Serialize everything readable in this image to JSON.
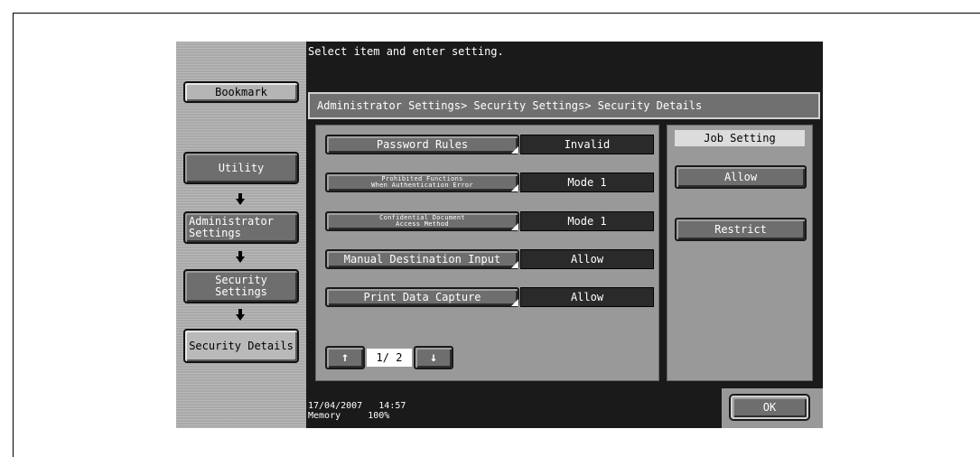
{
  "message": "Select item and enter setting.",
  "breadcrumb": "Administrator Settings> Security Settings> Security Details",
  "sidebar": {
    "bookmark_label": "Bookmark",
    "items": [
      {
        "label": "Utility"
      },
      {
        "label": "Administrator\nSettings"
      },
      {
        "label": "Security\nSettings"
      },
      {
        "label": "Security Details"
      }
    ]
  },
  "settings": [
    {
      "label": "Password Rules",
      "value": "Invalid"
    },
    {
      "label": "Prohibited Functions\nWhen Authentication Error",
      "value": "Mode 1"
    },
    {
      "label": "Confidential Document\nAccess Method",
      "value": "Mode 1"
    },
    {
      "label": "Manual Destination Input",
      "value": "Allow"
    },
    {
      "label": "Print Data Capture",
      "value": "Allow"
    }
  ],
  "pagination": {
    "page_text": "1/ 2",
    "up_icon": "arrow-up-icon",
    "down_icon": "arrow-down-icon"
  },
  "job_setting": {
    "title": "Job Setting",
    "options": [
      {
        "label": "Allow"
      },
      {
        "label": "Restrict"
      }
    ]
  },
  "status": {
    "date": "17/04/2007",
    "time": "14:57",
    "memory_label": "Memory",
    "memory_value": "100%"
  },
  "ok_label": "OK"
}
